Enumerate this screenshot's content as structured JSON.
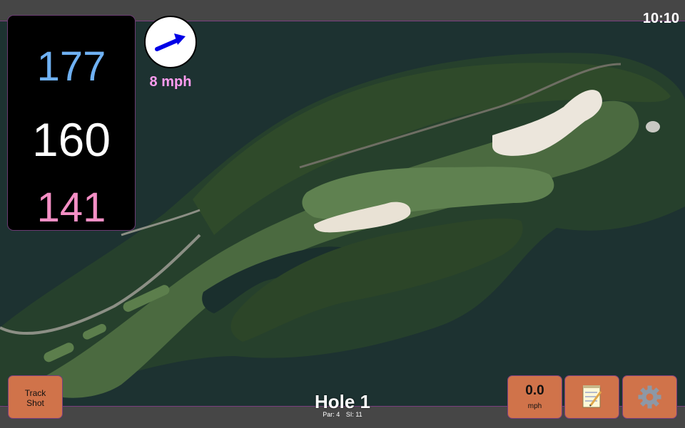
{
  "status": {
    "time": "10:10"
  },
  "distances": {
    "back": "177",
    "middle": "160",
    "front": "141"
  },
  "wind": {
    "speed_label": "8 mph"
  },
  "buttons": {
    "track_shot_line1": "Track",
    "track_shot_line2": "Shot",
    "speed_value": "0.0",
    "speed_unit": "mph"
  },
  "hole": {
    "title": "Hole 1",
    "par": "Par: 4",
    "si": "SI: 11"
  },
  "icons": {
    "notes": "notepad-icon",
    "settings": "gear-icon",
    "wind": "wind-arrow-icon"
  },
  "colors": {
    "back_distance": "#6fb1f3",
    "middle_distance": "#ffffff",
    "front_distance": "#f48fc5",
    "wind_label": "#ff9cf0",
    "button": "#d0734a",
    "accent_border": "#7a3e7e"
  }
}
